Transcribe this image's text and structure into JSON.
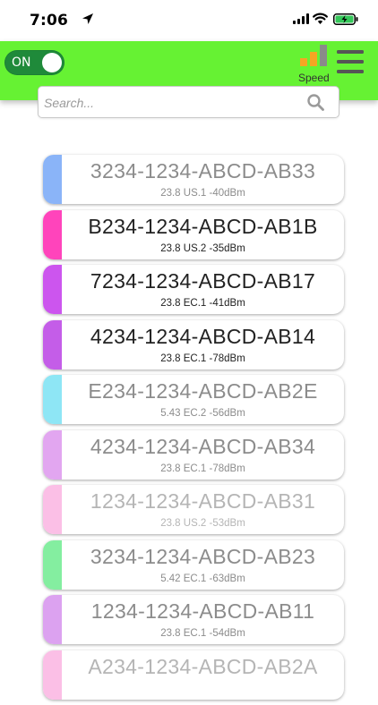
{
  "status_bar": {
    "time": "7:06"
  },
  "app_bar": {
    "toggle_label": "ON",
    "speed_label": "Speed",
    "colors": {
      "bar": "#66f233",
      "toggle_on": "#1f8a3a",
      "speed_low": "#f5a623",
      "speed_high": "#8a8a8a"
    }
  },
  "search": {
    "placeholder": "Search..."
  },
  "devices": [
    {
      "name": "3234-1234-ABCD-AB33",
      "info": "23.8 US.1 -40dBm",
      "color": "#8ab4f8",
      "tone": "dim"
    },
    {
      "name": "B234-1234-ABCD-AB1B",
      "info": "23.8 US.2 -35dBm",
      "color": "#ff44bb",
      "tone": "dark"
    },
    {
      "name": "7234-1234-ABCD-AB17",
      "info": "23.8 EC.1 -41dBm",
      "color": "#cc55ee",
      "tone": "dark"
    },
    {
      "name": "4234-1234-ABCD-AB14",
      "info": "23.8 EC.1 -78dBm",
      "color": "#c45de8",
      "tone": "dark"
    },
    {
      "name": "E234-1234-ABCD-AB2E",
      "info": "5.43 EC.2 -56dBm",
      "color": "#8ee6f5",
      "tone": "dim"
    },
    {
      "name": "4234-1234-ABCD-AB34",
      "info": "23.8 EC.1 -78dBm",
      "color": "#e2a6f0",
      "tone": "dim"
    },
    {
      "name": "1234-1234-ABCD-AB31",
      "info": "23.8 US.2 -53dBm",
      "color": "#fbbfe6",
      "tone": "light"
    },
    {
      "name": "3234-1234-ABCD-AB23",
      "info": "5.42 EC.1 -63dBm",
      "color": "#84eea0",
      "tone": "dim"
    },
    {
      "name": "1234-1234-ABCD-AB11",
      "info": "23.8 EC.1 -54dBm",
      "color": "#dca2f0",
      "tone": "dim"
    },
    {
      "name": "A234-1234-ABCD-AB2A",
      "info": "",
      "color": "#fbbfe6",
      "tone": "light"
    }
  ]
}
